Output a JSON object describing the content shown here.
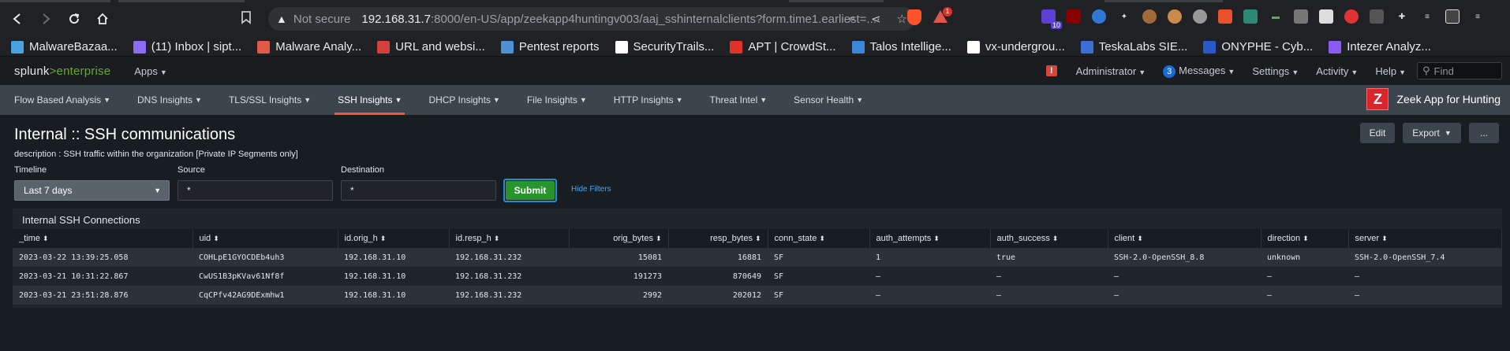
{
  "browser": {
    "security_label": "Not secure",
    "url_host": "192.168.31.7",
    "url_rest": ":8000/en-US/app/zeekapp4huntingv003/aaj_sshinternalclients?form.time1.earliest=...",
    "extension_badge": "10",
    "rewards_count": "1"
  },
  "bookmarks": [
    {
      "label": "MalwareBazaa...",
      "icon": "malware-bazaar-icon",
      "color": "#4aa3df"
    },
    {
      "label": "(11) Inbox | sipt...",
      "icon": "proton-mail-icon",
      "color": "#8c6cf2"
    },
    {
      "label": "Malware Analy...",
      "icon": "any-run-icon",
      "color": "#e05a47"
    },
    {
      "label": "URL and websi...",
      "icon": "urlscan-icon",
      "color": "#d2413b"
    },
    {
      "label": "Pentest reports",
      "icon": "pentest-icon",
      "color": "#4f8fd6"
    },
    {
      "label": "SecurityTrails...",
      "icon": "securitytrails-icon",
      "color": "#ffffff"
    },
    {
      "label": "APT | CrowdSt...",
      "icon": "crowdstrike-icon",
      "color": "#e0312b"
    },
    {
      "label": "Talos Intellige...",
      "icon": "talos-icon",
      "color": "#3a86d8"
    },
    {
      "label": "vx-undergrou...",
      "icon": "vx-underground-icon",
      "color": "#ffffff"
    },
    {
      "label": "TeskaLabs SIE...",
      "icon": "teskalabs-icon",
      "color": "#3d6ed8"
    },
    {
      "label": "ONYPHE - Cyb...",
      "icon": "onyphe-icon",
      "color": "#2b59c9"
    },
    {
      "label": "Intezer Analyz...",
      "icon": "intezer-icon",
      "color": "#8a5cf0"
    }
  ],
  "splunk": {
    "logo_main": "splunk",
    "logo_gt": ">",
    "logo_product": "enterprise",
    "apps": "Apps",
    "alert_glyph": "!",
    "admin": "Administrator",
    "messages_count": "3",
    "messages": "Messages",
    "settings": "Settings",
    "activity": "Activity",
    "help": "Help",
    "find_placeholder": "Find"
  },
  "app_nav": {
    "items": [
      {
        "label": "Flow Based Analysis"
      },
      {
        "label": "DNS Insights"
      },
      {
        "label": "TLS/SSL Insights"
      },
      {
        "label": "SSH Insights"
      },
      {
        "label": "DHCP Insights"
      },
      {
        "label": "File Insights"
      },
      {
        "label": "HTTP Insights"
      },
      {
        "label": "Threat Intel"
      },
      {
        "label": "Sensor Health"
      }
    ],
    "active_index": 3,
    "brand_logo": "Z",
    "brand_name": "Zeek App for Hunting"
  },
  "dashboard": {
    "title": "Internal :: SSH communications",
    "description": "description : SSH traffic within the organization [Private IP Segments only]",
    "actions": {
      "edit": "Edit",
      "export": "Export",
      "more": "..."
    },
    "filters": {
      "timeline_label": "Timeline",
      "timeline_value": "Last 7 days",
      "source_label": "Source",
      "source_value": "*",
      "destination_label": "Destination",
      "destination_value": "*",
      "submit": "Submit",
      "hide_filters": "Hide Filters"
    },
    "panel": {
      "title": "Internal SSH Connections",
      "columns": [
        "_time",
        "uid",
        "id.orig_h",
        "id.resp_h",
        "orig_bytes",
        "resp_bytes",
        "conn_state",
        "auth_attempts",
        "auth_success",
        "client",
        "direction",
        "server"
      ],
      "rows": [
        [
          "2023-03-22 13:39:25.058",
          "COHLpE1GYOCDEb4uh3",
          "192.168.31.10",
          "192.168.31.232",
          "15081",
          "16881",
          "SF",
          "1",
          "true",
          "SSH-2.0-OpenSSH_8.8",
          "unknown",
          "SSH-2.0-OpenSSH_7.4"
        ],
        [
          "2023-03-21 10:31:22.867",
          "CwUS1B3pKVav61Nf8f",
          "192.168.31.10",
          "192.168.31.232",
          "191273",
          "870649",
          "SF",
          "–",
          "–",
          "–",
          "–",
          "–"
        ],
        [
          "2023-03-21 23:51:28.876",
          "CqCPfv42AG9DExmhw1",
          "192.168.31.10",
          "192.168.31.232",
          "2992",
          "202012",
          "SF",
          "–",
          "–",
          "–",
          "–",
          "–"
        ]
      ]
    }
  }
}
